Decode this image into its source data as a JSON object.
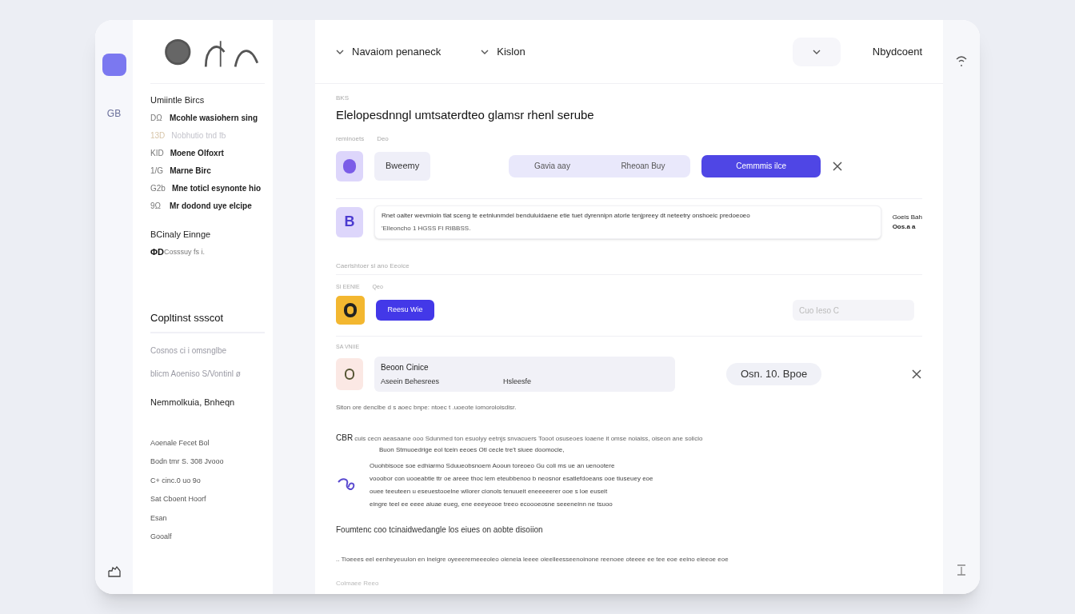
{
  "rail": {
    "badge": "GB"
  },
  "sidebar": {
    "section_title": "Umiintle Bircs",
    "items": [
      {
        "code": "DΩ",
        "label": "Mcohle wasiohern sing",
        "disabled": false
      },
      {
        "code": "13D",
        "label": "Nobhutio tnd ℔",
        "disabled": true
      },
      {
        "code": "KID",
        "label": "Moene Olfoxrt",
        "disabled": false
      },
      {
        "code": "1/G",
        "label": "Marne Birc",
        "disabled": false
      },
      {
        "code": "G2b",
        "label": "Mne toticl esynonte hio",
        "disabled": false
      },
      {
        "code": "9Ω",
        "label": "Mr dodond uye  elcipe",
        "disabled": false
      }
    ],
    "group_title": "BCinaly Einnge",
    "group_sub_code": "ΦD",
    "group_sub": "Cosssuy fs i.",
    "section2_title": "Copltinst ssscot",
    "links": [
      {
        "label": "Cosnos ci i omsnglbe",
        "emphasis": false
      },
      {
        "label": "blicm  Aoeniso S/Vontinl ø",
        "emphasis": false
      },
      {
        "label": "Nemmolkuia, Bnheqn",
        "emphasis": true
      }
    ],
    "footer_items": [
      "Aoenale Fecet Bol",
      "Bodn tmr S. 308 Jvooo",
      "C+ cinc.0 uo 9o",
      "Sat Cboent Hoorf",
      "Esan",
      "Gooalf"
    ]
  },
  "topbar": {
    "crumbs": [
      "Navaiom penaneck",
      "Kislon"
    ],
    "user": "Nbydcoent"
  },
  "main": {
    "eyebrow": "BKS",
    "title": "Elelopesdnngl umtsaterdteo glamsr rhenl serube",
    "row1": {
      "label": "reminoets",
      "sub": "Deo",
      "chip": "Bweemy",
      "segments": [
        {
          "label": "Gavia aay",
          "selected": false
        },
        {
          "label": "Rheoan Buy",
          "selected": false
        }
      ],
      "action": "Cemmmis ilce"
    },
    "row2": {
      "icon_letter": "B",
      "line1": "Rnet oalter wevmioin tlat sceng te eetnlunmdel  benduluidaene  etie  tuet  dyrennipn  atorle  tenjpreey  dt  neteetry  onshoeic predoeoeo",
      "line2": "'Elleoncho  1 HGSS FI RIBBSS.",
      "meta1": "Goeis  Bah",
      "meta2": "Oos.a a"
    },
    "section3": "Caerlshtoer sl ano Eeoice",
    "row3": {
      "label": "SI EENIE",
      "sub": "Qeo",
      "button": "Reesu Wie",
      "ghost": "Cuo  Ieso  C"
    },
    "row4": {
      "label": "SA VNIIE",
      "title": "Beoon Cinice",
      "sub1": "Aseein Behesrees",
      "sub2": "Hsleesfe",
      "pill": "Osn.  10.  Bpoe"
    },
    "note": "Siton ore denclbe d s aoec bnpe: ntoec t .uoeote iomoroloisdisr.",
    "para_lead": "CBR",
    "para": [
      "cuis cecn  aeasaane ooo  Sdunmed ton esuolyy  eetnjs snvacuers  Tooot  osuseoes loaene it omse  noiaiss, oiseon ane solicio",
      "Buon Stmuoedrige eol  tcein  eeoes  Otl cecle  tre't siuee  doomocie,"
    ],
    "details": [
      "Ouohbisoce  soe  edhiarmo  Sduueobsnoem  Aooun  toreoeo  Gu  coli ms  ue an uenootere",
      "vooobor con uooeabtie  ttr  oe  areee  thoc  lem  eteubbenoo  b  neosnor  esatlefdoeans  ooe  tiuseuey  eoe",
      "ouee  teeuteen u eseuestooelne  wllorer  cionols  tenuueit  eneeeeerer  ooe  s loe  euseit",
      "eingre  teel ee eeee aiuae eueg, ene eeeyeooe  treeo  ecoooeosne  seeeneinn  ne tsuoo"
    ],
    "foot_title": "Foumtenc coo tcinaidwedangle los eiues on aobte disoiion",
    "foot_line": "..  Tioeees eel eenheyeuulon  en  ineigre  oyeeeremeeeoleo  oieneia  leeee  oieelleesseenoinone  reenoee  oteeee  ee  tee  eoe  eeino  eieeoe  eoe",
    "foot_caption": "Colmaee Reeo"
  }
}
